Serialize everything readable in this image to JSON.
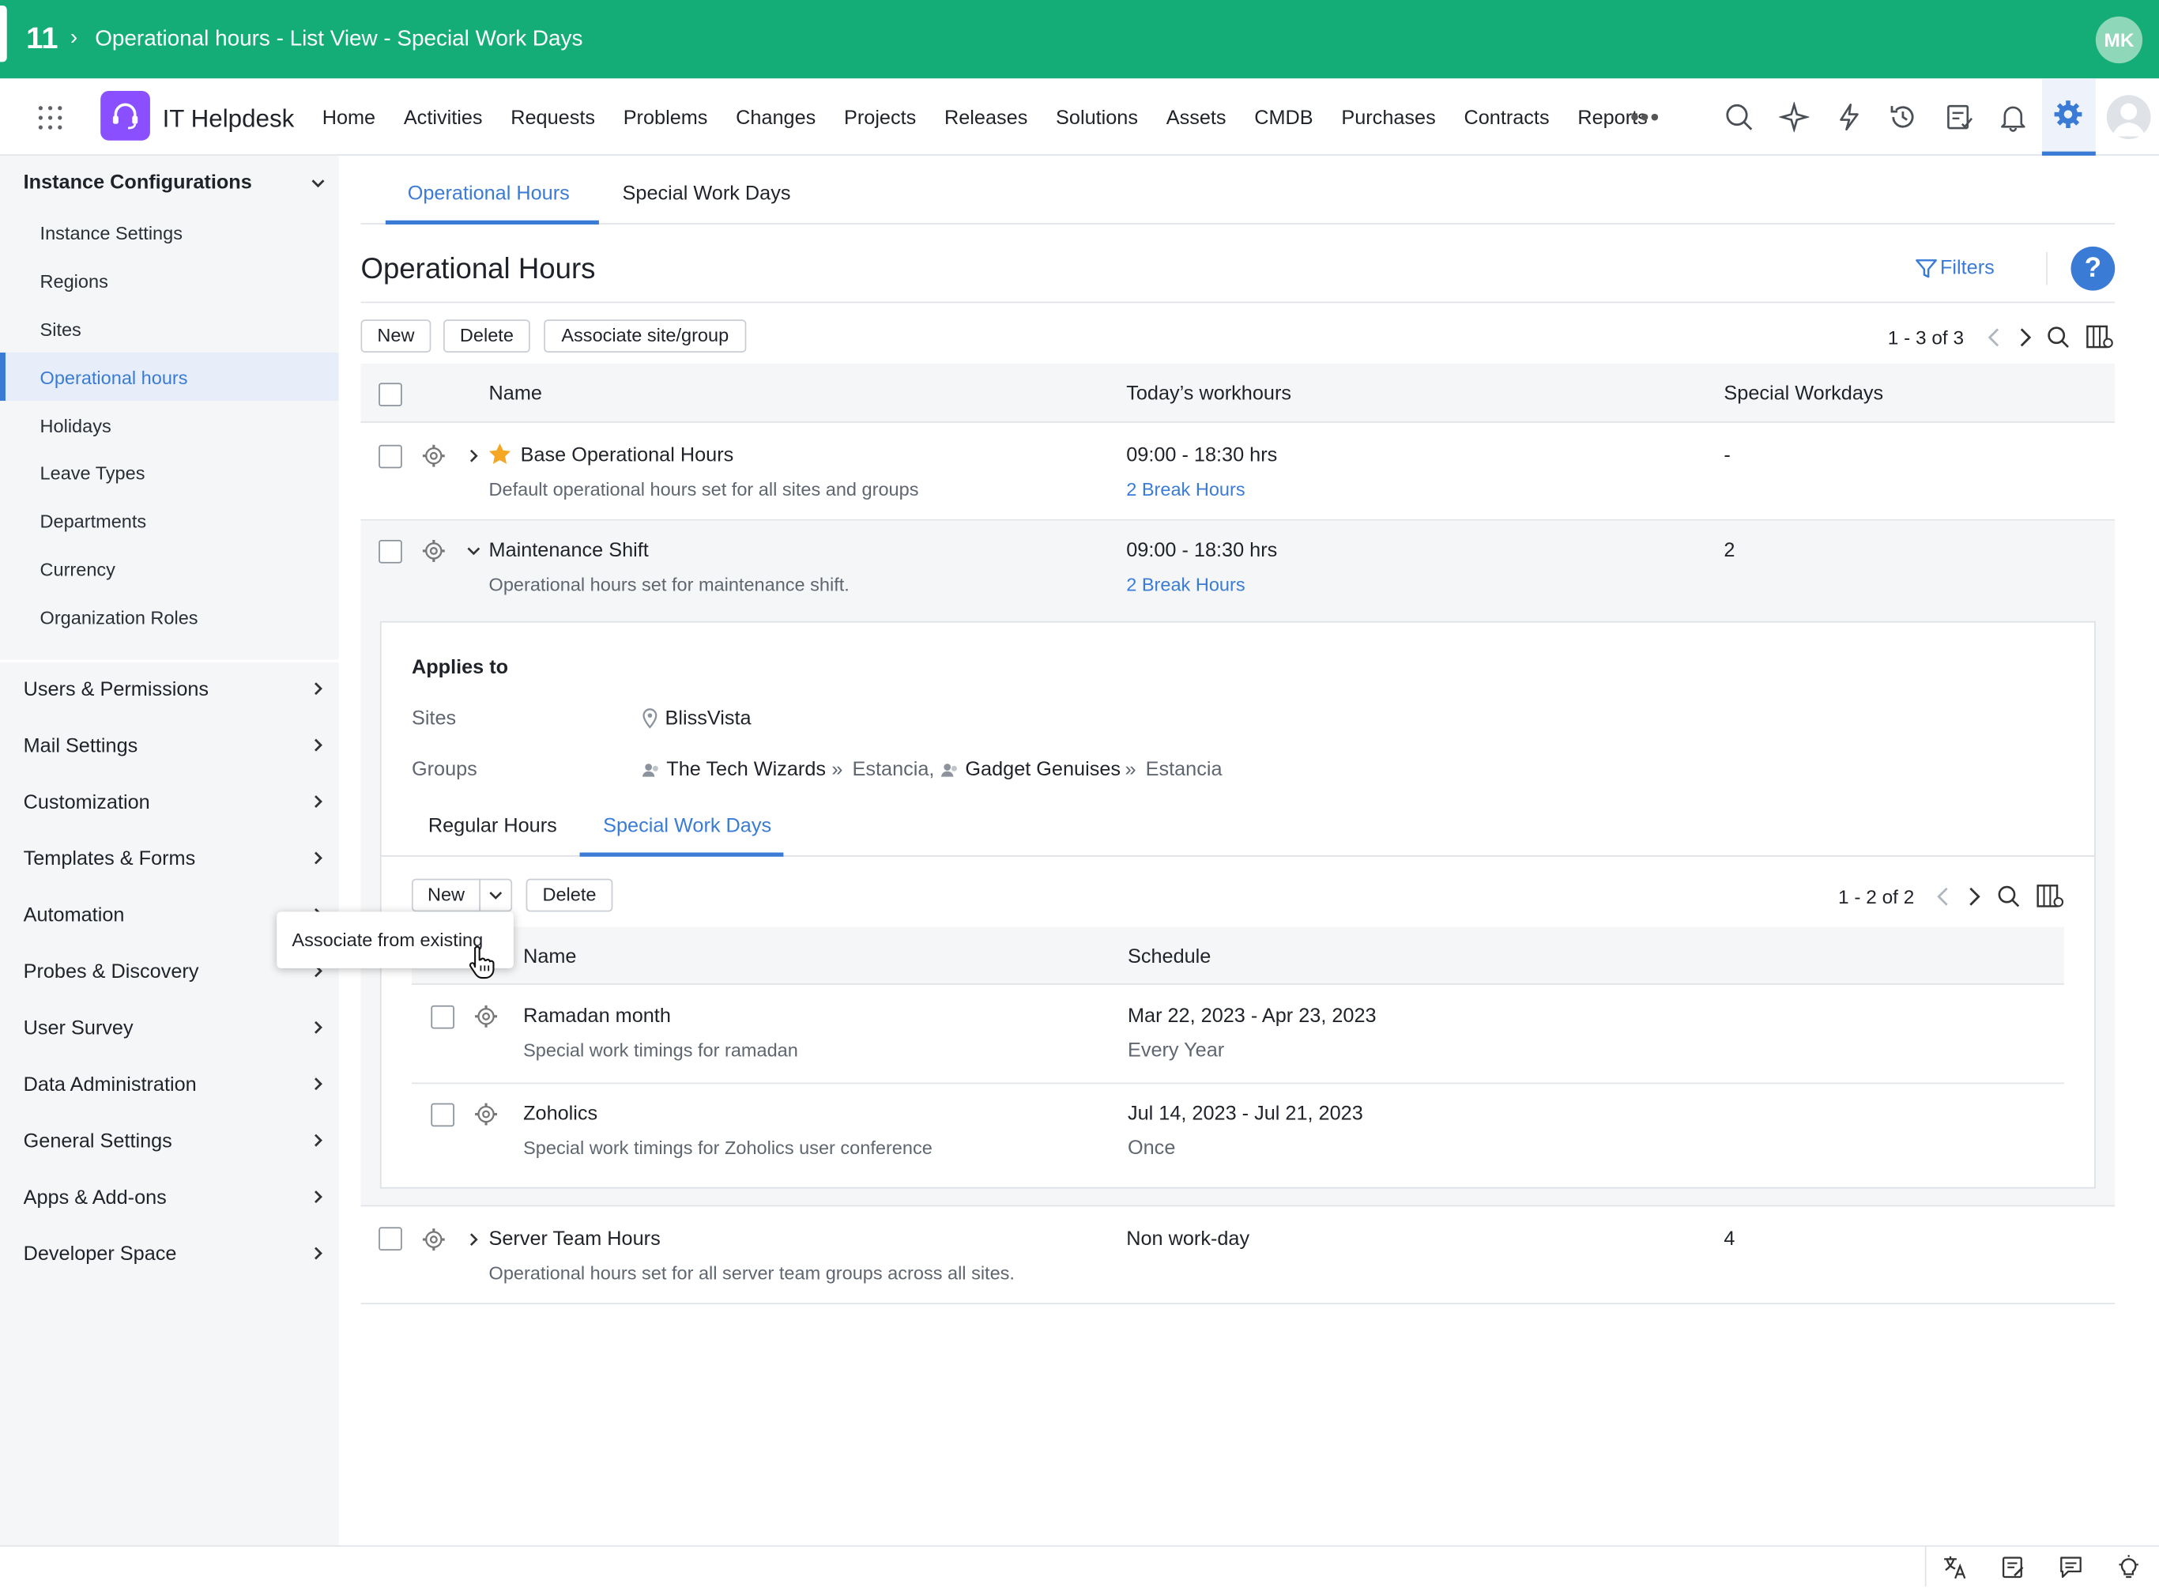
{
  "topbar": {
    "number": "11",
    "separator": "›",
    "title": "Operational hours - List View - Special Work Days",
    "user_initials": "MK"
  },
  "app": {
    "name": "IT Helpdesk"
  },
  "nav": {
    "items": [
      "Home",
      "Activities",
      "Requests",
      "Problems",
      "Changes",
      "Projects",
      "Releases",
      "Solutions",
      "Assets",
      "CMDB",
      "Purchases",
      "Contracts",
      "Reports"
    ],
    "more": "•••"
  },
  "sidebar": {
    "section_title": "Instance Configurations",
    "sub_items": [
      "Instance Settings",
      "Regions",
      "Sites",
      "Operational hours",
      "Holidays",
      "Leave Types",
      "Departments",
      "Currency",
      "Organization Roles"
    ],
    "active_item": "Operational hours",
    "sections": [
      "Users & Permissions",
      "Mail Settings",
      "Customization",
      "Templates & Forms",
      "Automation",
      "Probes & Discovery",
      "User Survey",
      "Data Administration",
      "General Settings",
      "Apps & Add-ons",
      "Developer Space"
    ]
  },
  "tabs": [
    "Operational Hours",
    "Special Work Days"
  ],
  "page": {
    "title": "Operational Hours",
    "filters": "Filters",
    "help": "?"
  },
  "toolbar": {
    "new": "New",
    "delete": "Delete",
    "associate": "Associate site/group",
    "pager": "1 - 3 of 3"
  },
  "table": {
    "headers": [
      "Name",
      "Today’s workhours",
      "Special Workdays"
    ],
    "rows": [
      {
        "name": "Base Operational Hours",
        "desc": "Default operational hours set for all sites and groups",
        "hours": "09:00 - 18:30 hrs",
        "break": "2 Break Hours",
        "special": "-"
      },
      {
        "name": "Maintenance Shift",
        "desc": "Operational hours set for maintenance shift.",
        "hours": "09:00 - 18:30 hrs",
        "break": "2 Break Hours",
        "special": "2"
      },
      {
        "name": "Server Team Hours",
        "desc": "Operational hours set for all server team groups across all sites.",
        "hours": "Non work-day",
        "break": "",
        "special": "4"
      }
    ]
  },
  "applies": {
    "title": "Applies to",
    "sites_label": "Sites",
    "site": "BlissVista",
    "groups_label": "Groups",
    "group1": "The Tech Wizards",
    "group1_site": "Estancia,",
    "group2": "Gadget Genuises",
    "group2_site": "Estancia",
    "arrow": "»"
  },
  "subtabs": [
    "Regular Hours",
    "Special Work Days"
  ],
  "subtoolbar": {
    "new": "New",
    "delete": "Delete",
    "pager": "1 - 2 of 2"
  },
  "subtable": {
    "headers": [
      "Name",
      "Schedule"
    ],
    "rows": [
      {
        "name": "Ramadan month",
        "desc": "Special work timings for ramadan",
        "dates": "Mar 22, 2023 - Apr 23, 2023",
        "recurrence": "Every Year"
      },
      {
        "name": "Zoholics",
        "desc": "Special work timings for Zoholics user conference",
        "dates": "Jul 14, 2023 - Jul 21, 2023",
        "recurrence": "Once"
      }
    ]
  },
  "tooltip": {
    "text": "Associate from existing"
  },
  "colors": {
    "topbar": "#14ad78",
    "accent": "#3a7bd5",
    "logo": "#8a4fff",
    "star": "#f5a623"
  }
}
